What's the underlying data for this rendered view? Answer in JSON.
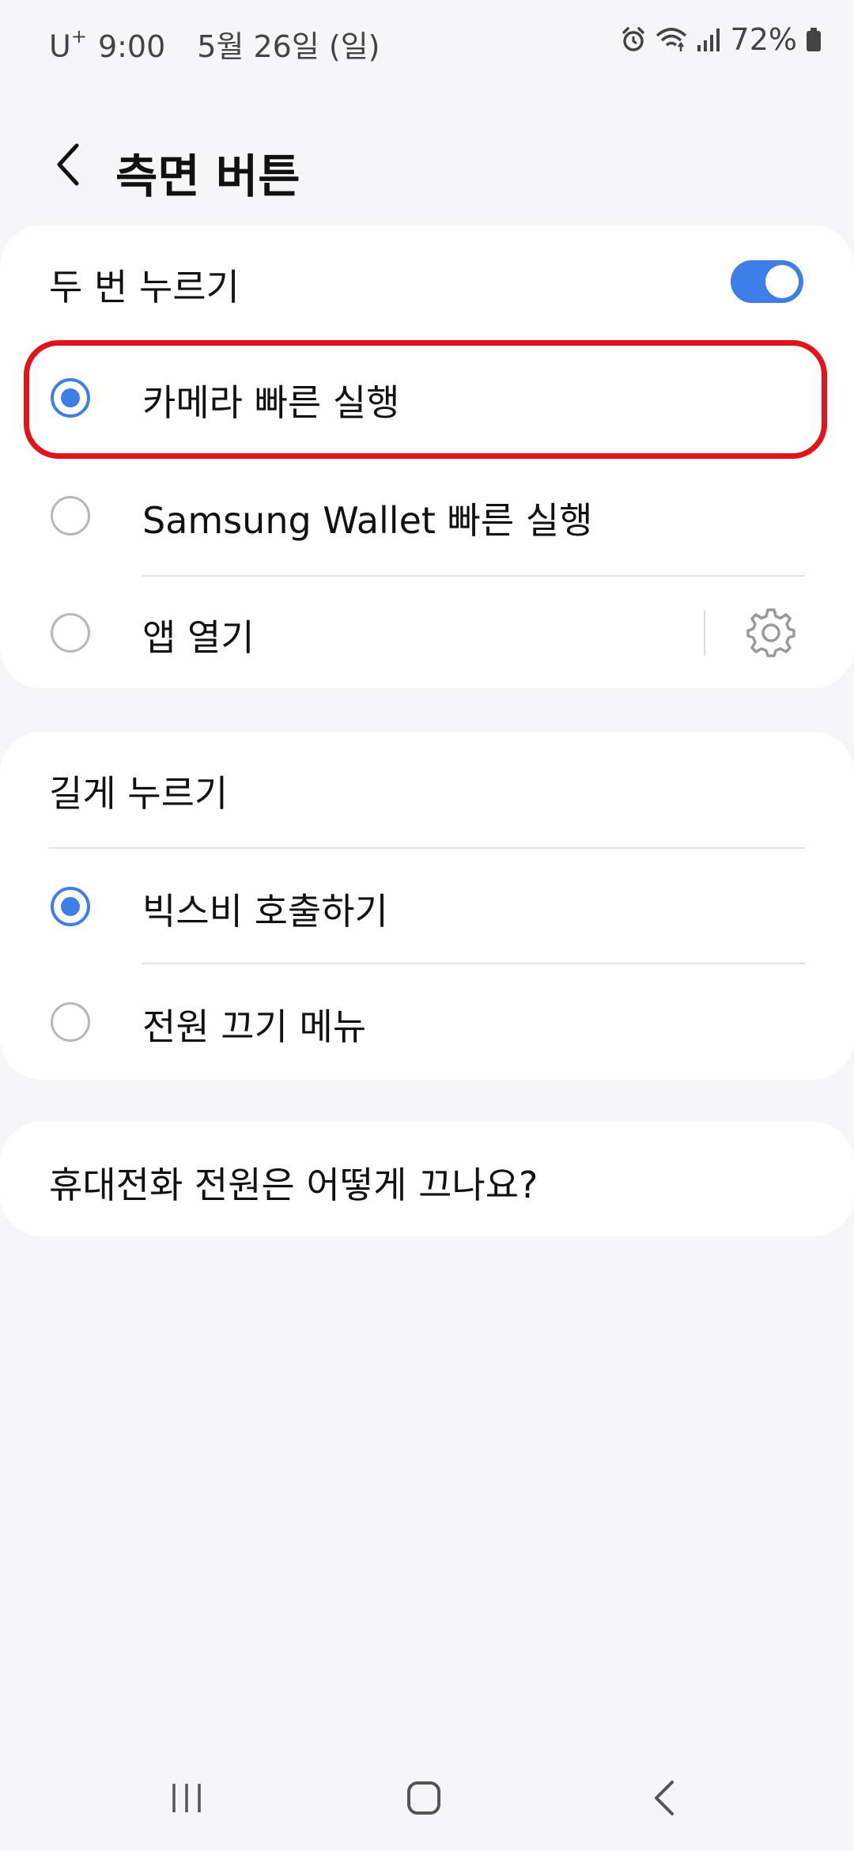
{
  "status": {
    "carrier": "U",
    "carrier_sup": "+",
    "time": "9:00",
    "date": "5월 26일 (일)",
    "battery": "72%"
  },
  "header": {
    "title": "측면 버튼"
  },
  "double_press": {
    "title": "두 번 누르기",
    "enabled": true,
    "options": [
      {
        "label": "카메라 빠른 실행",
        "selected": true
      },
      {
        "label": "Samsung Wallet 빠른 실행",
        "selected": false
      },
      {
        "label": "앱 열기",
        "selected": false
      }
    ]
  },
  "long_press": {
    "title": "길게 누르기",
    "options": [
      {
        "label": "빅스비 호출하기",
        "selected": true
      },
      {
        "label": "전원 끄기 메뉴",
        "selected": false
      }
    ]
  },
  "help_link": "휴대전화 전원은 어떻게 끄나요?",
  "colors": {
    "accent": "#3f7ee8",
    "highlight": "#e1141c",
    "background": "#f6f6f8",
    "card": "#ffffff"
  },
  "icons": [
    "alarm-icon",
    "wifi-icon",
    "signal-icon",
    "battery-icon",
    "back-arrow-icon",
    "gear-icon",
    "recents-icon",
    "home-icon",
    "nav-back-icon"
  ]
}
